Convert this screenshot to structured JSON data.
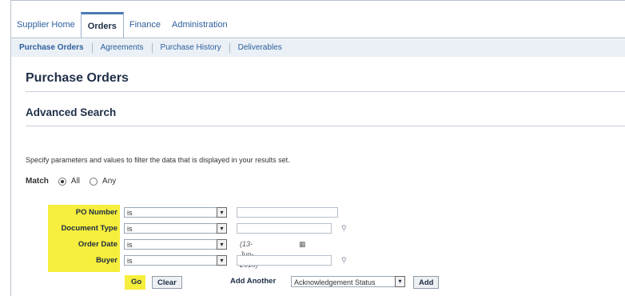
{
  "tabs": [
    {
      "label": "Supplier Home",
      "active": false
    },
    {
      "label": "Orders",
      "active": true
    },
    {
      "label": "Finance",
      "active": false
    },
    {
      "label": "Administration",
      "active": false
    }
  ],
  "subtabs": [
    {
      "label": "Purchase Orders",
      "active": true
    },
    {
      "label": "Agreements",
      "active": false
    },
    {
      "label": "Purchase History",
      "active": false
    },
    {
      "label": "Deliverables",
      "active": false
    }
  ],
  "page_title": "Purchase Orders",
  "section_title": "Advanced Search",
  "instructions": "Specify parameters and values to filter the data that is displayed in your results set.",
  "match": {
    "label": "Match",
    "options": [
      {
        "label": "All",
        "selected": true
      },
      {
        "label": "Any",
        "selected": false
      }
    ]
  },
  "criteria": [
    {
      "label": "PO Number",
      "operator": "is",
      "value": ""
    },
    {
      "label": "Document Type",
      "operator": "is",
      "value": ""
    },
    {
      "label": "Order Date",
      "operator": "is",
      "value": "",
      "hint": "(13-Jun-2018)"
    },
    {
      "label": "Buyer",
      "operator": "is",
      "value": ""
    }
  ],
  "buttons": {
    "go": "Go",
    "clear": "Clear",
    "add_another_label": "Add Another",
    "add_another_selected": "Acknowledgement Status",
    "add": "Add"
  },
  "colors": {
    "highlight": "#f6ee3c",
    "link": "#2d5e9b",
    "active_tab_accent": "#4a7ab5"
  }
}
